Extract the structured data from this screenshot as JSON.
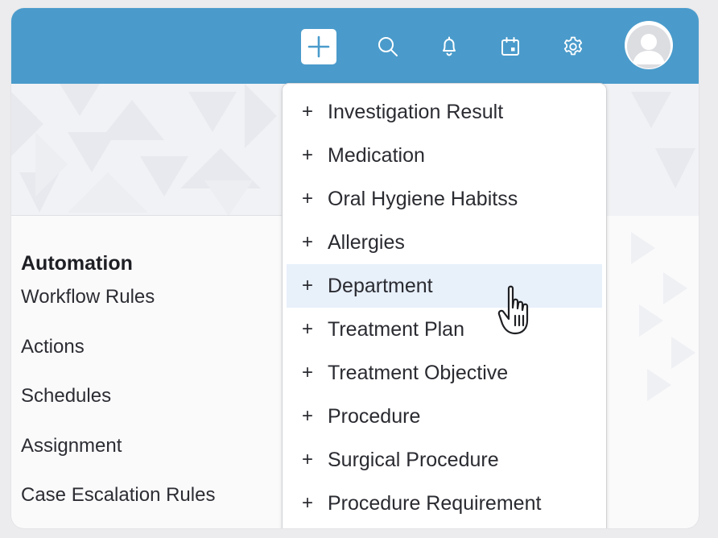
{
  "topbar": {
    "icons": [
      "plus-icon",
      "search-icon",
      "bell-icon",
      "calendar-icon",
      "gear-icon",
      "avatar"
    ]
  },
  "sidebar": {
    "heading": "Automation",
    "items": [
      {
        "label": "Workflow Rules"
      },
      {
        "label": "Actions"
      },
      {
        "label": "Schedules"
      },
      {
        "label": "Assignment"
      },
      {
        "label": "Case Escalation Rules"
      }
    ]
  },
  "dropdown": {
    "plus_symbol": "+",
    "hovered_item": "Department",
    "items": [
      {
        "label": "Investigation Result"
      },
      {
        "label": "Medication"
      },
      {
        "label": "Oral Hygiene Habitss"
      },
      {
        "label": "Allergies"
      },
      {
        "label": "Department"
      },
      {
        "label": "Treatment Plan"
      },
      {
        "label": "Treatment Objective"
      },
      {
        "label": "Procedure"
      },
      {
        "label": "Surgical Procedure"
      },
      {
        "label": "Procedure Requirement"
      }
    ]
  },
  "colors": {
    "topbar": "#4a9bcb",
    "hover_row": "#e8f0fa",
    "page_bg": "#fafafb"
  }
}
